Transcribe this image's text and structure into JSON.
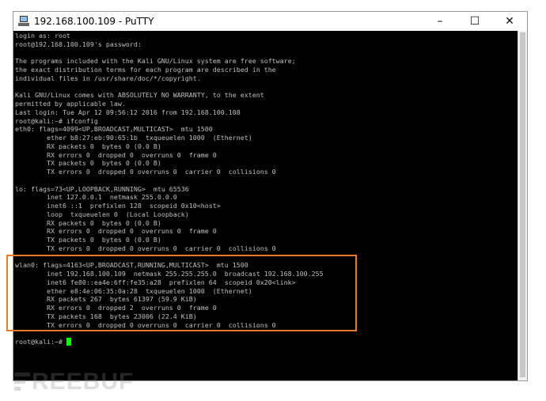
{
  "window": {
    "title": "192.168.100.109 - PuTTY",
    "app_icon": "putty-icon",
    "controls": {
      "minimize": "–",
      "maximize": "☐",
      "close": "✕"
    }
  },
  "terminal": {
    "lines": [
      "login as: root",
      "root@192.168.100.109's password:",
      "",
      "The programs included with the Kali GNU/Linux system are free software;",
      "the exact distribution terms for each program are described in the",
      "individual files in /usr/share/doc/*/copyright.",
      "",
      "Kali GNU/Linux comes with ABSOLUTELY NO WARRANTY, to the extent",
      "permitted by applicable law.",
      "Last login: Tue Apr 12 09:56:12 2016 from 192.168.100.108",
      "root@kali:~# ifconfig",
      "eth0: flags=4099<UP,BROADCAST,MULTICAST>  mtu 1500",
      "        ether b8:27:eb:90:65:1b  txqueuelen 1000  (Ethernet)",
      "        RX packets 0  bytes 0 (0.0 B)",
      "        RX errors 0  dropped 0  overruns 0  frame 0",
      "        TX packets 0  bytes 0 (0.0 B)",
      "        TX errors 0  dropped 0 overruns 0  carrier 0  collisions 0",
      "",
      "lo: flags=73<UP,LOOPBACK,RUNNING>  mtu 65536",
      "        inet 127.0.0.1  netmask 255.0.0.0",
      "        inet6 ::1  prefixlen 128  scopeid 0x10<host>",
      "        loop  txqueuelen 0  (Local Loopback)",
      "        RX packets 0  bytes 0 (0.0 B)",
      "        RX errors 0  dropped 0  overruns 0  frame 0",
      "        TX packets 0  bytes 0 (0.0 B)",
      "        TX errors 0  dropped 0 overruns 0  carrier 0  collisions 0",
      "",
      "wlan0: flags=4163<UP,BROADCAST,RUNNING,MULTICAST>  mtu 1500",
      "        inet 192.168.100.109  netmask 255.255.255.0  broadcast 192.168.100.255",
      "        inet6 fe80::ea4e:6ff:fe35:a28  prefixlen 64  scopeid 0x20<link>",
      "        ether e8:4e:06:35:0a:28  txqueuelen 1000  (Ethernet)",
      "        RX packets 267  bytes 61397 (59.9 KiB)",
      "        RX errors 0  dropped 2  overruns 0  frame 0",
      "        TX packets 168  bytes 23006 (22.4 KiB)",
      "        TX errors 0  dropped 0 overruns 0  carrier 0  collisions 0",
      "",
      "root@kali:~# "
    ],
    "cursor_color": "#00ff00",
    "text_color": "#c0c0c0",
    "background_color": "#000000"
  },
  "highlight": {
    "color": "#ea7a2a"
  },
  "watermark": {
    "text": "REEBUF"
  }
}
